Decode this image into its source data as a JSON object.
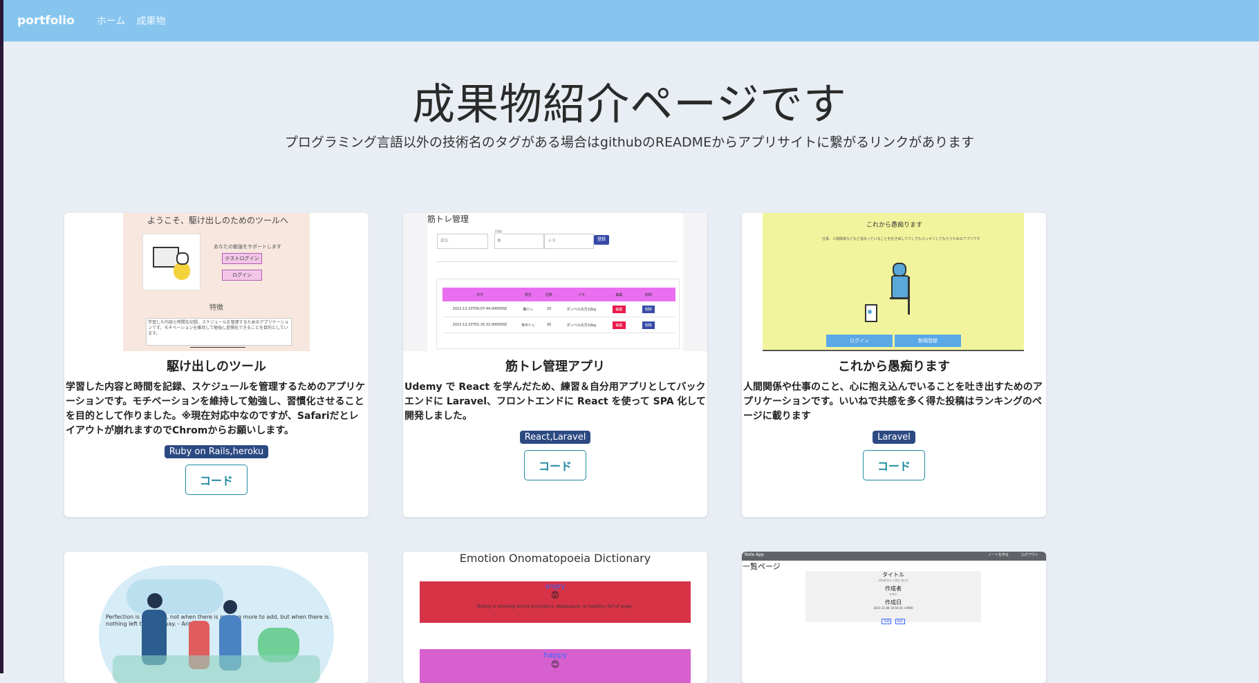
{
  "nav": {
    "brand": "portfolio",
    "links": [
      "ホーム",
      "成果物"
    ]
  },
  "hero": {
    "title": "成果物紹介ページです",
    "subtitle": "プログラミング言語以外の技術名のタグがある場合はgithubのREADMEからアプリサイトに繋がるリンクがあります"
  },
  "cards": [
    {
      "title": "駆け出しのツール",
      "description": "学習した内容と時間を記録、スケジュールを管理するためのアプリケーションです。モチベーションを維持して勉強し、習慣化させることを目的として作りました。※現在対応中なのですが、Safariだとレイアウトが崩れますのでChromからお願いします。",
      "tag": "Ruby on Rails,heroku",
      "button": "コード",
      "thumb": {
        "heading": "ようこそ、駆け出しのためのツールへ",
        "support": "あなたの勉強をサポートします",
        "btn1": "テストログイン",
        "btn2": "ログイン",
        "feature": "特徴",
        "feature_text": "学習した内容と時間を記録、スケジュールを管理するためのアプリケーションです。モチベーションを維持して勉強し習慣化できることを目的としています。"
      }
    },
    {
      "title": "筋トレ管理アプリ",
      "description": "Udemy で React を学んだため、練習＆自分用アプリとしてバックエンドに Laravel、フロントエンドに React を使って SPA 化して開発しました。",
      "tag": "React,Laravel",
      "button": "コード",
      "thumb": {
        "heading": "筋トレ管理",
        "field1": "部位",
        "field2_label": "回数",
        "field2": "0",
        "field3": "メモ",
        "submit": "登録",
        "headers": [
          "日付",
          "部位",
          "回数",
          "メモ",
          "編集",
          "削除"
        ],
        "rows": [
          [
            "2021-12-23T00:07:44.000000Z",
            "胸トレ",
            "20",
            "ダンベルの方10kg",
            "編集",
            "削除"
          ],
          [
            "2021-12-23T01:25:32.000000Z",
            "背中トレ",
            "30",
            "ダンベルの方10kg",
            "編集",
            "削除"
          ]
        ]
      }
    },
    {
      "title": "これから愚痴ります",
      "description": "人間関係や仕事のこと、心に抱え込んでいることを吐き出すためのアプリケーションです。いいねで共感を多く得た投稿はランキングのページに載ります",
      "tag": "Laravel",
      "button": "コード",
      "thumb": {
        "heading": "これから愚痴ります",
        "sub": "仕事、人間関係などなど溜まっていることを吐き出して少しでもスッキリしてもらうためのアプリです",
        "btn1": "ログイン",
        "btn2": "新規登録"
      }
    },
    {
      "thumb": {
        "quote": "Perfection is achieved, not when there is nothing more to add, but when there is nothing left to take away. - Antoine"
      }
    },
    {
      "thumb": {
        "heading": "Emotion Onomatopoeia Dictionary",
        "band1_title": "angry",
        "band1_emoji": "😡",
        "band1_text": "feeling or showing strong annoyance, displeasure, or hostility; full of anger.",
        "band2_title": "happy",
        "band2_emoji": "😊"
      }
    },
    {
      "thumb": {
        "app": "Note App",
        "nav_right": [
          "ノートを作る",
          "ログアウト"
        ],
        "page": "一覧ページ",
        "label_title": "タイトル",
        "title_val": "プログラミングについて",
        "label_author": "作成者",
        "author_val": "テスト",
        "label_date": "作成日",
        "date_val": "2021-11-08 10:56:35 +0900",
        "btn1": "詳細",
        "btn2": "削除"
      }
    }
  ],
  "colors": {
    "navbar": "#87c5ef",
    "background": "#e9eef5",
    "tag": "#2c4a82",
    "code_button": "#1e8aa0"
  }
}
